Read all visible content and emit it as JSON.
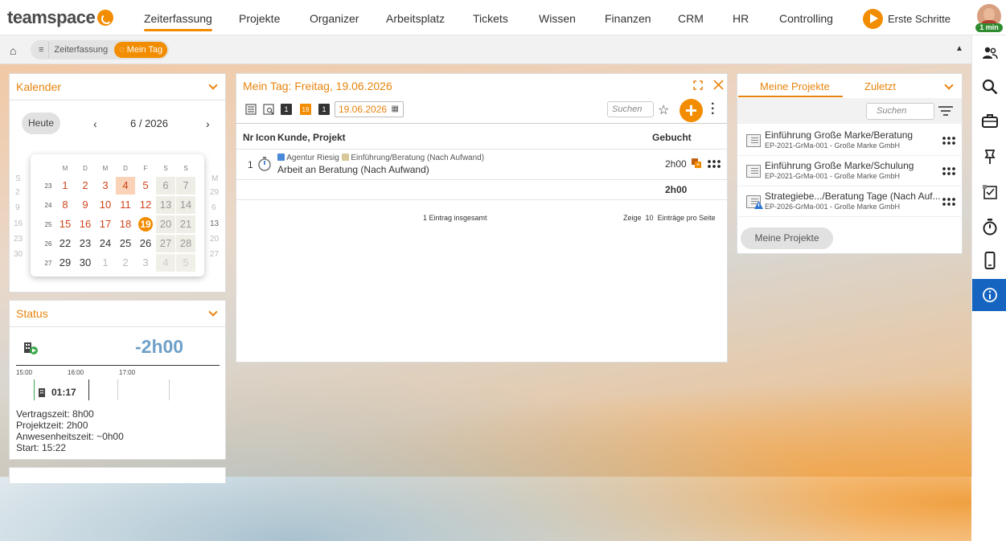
{
  "nav": {
    "logo": "teamspace",
    "items": [
      "Zeiterfassung",
      "Projekte",
      "Organizer",
      "Arbeitsplatz",
      "Tickets",
      "Wissen",
      "Finanzen",
      "CRM",
      "HR",
      "Controlling"
    ],
    "active": "Zeiterfassung",
    "erste_schritte": "Erste Schritte",
    "timer_badge": "1 min"
  },
  "breadcrumb": {
    "home_icon": "home-icon",
    "menu_glyph": "≡",
    "items": [
      "Zeiterfassung",
      "Mein Tag"
    ],
    "collapse_glyph": "▲"
  },
  "colors": {
    "accent": "#f28c00",
    "status_blue": "#6fa0c8",
    "active_sidebar": "#1565c0"
  },
  "kalender": {
    "title": "Kalender",
    "today_button": "Heute",
    "month": "6 / 2026",
    "prev": "‹",
    "next": "›",
    "weekday_headers": [
      "M",
      "D",
      "M",
      "D",
      "F",
      "S",
      "S"
    ],
    "weeks": [
      {
        "nr": "23",
        "days": [
          "1",
          "2",
          "3",
          "4",
          "5",
          "6",
          "7"
        ]
      },
      {
        "nr": "24",
        "days": [
          "8",
          "9",
          "10",
          "11",
          "12",
          "13",
          "14"
        ]
      },
      {
        "nr": "25",
        "days": [
          "15",
          "16",
          "17",
          "18",
          "19",
          "20",
          "21"
        ]
      },
      {
        "nr": "26",
        "days": [
          "22",
          "23",
          "24",
          "25",
          "26",
          "27",
          "28"
        ]
      },
      {
        "nr": "27",
        "days": [
          "29",
          "30",
          "1",
          "2",
          "3",
          "4",
          "5"
        ]
      }
    ],
    "ghost_left": {
      "header": "S",
      "days": [
        "2",
        "9",
        "16",
        "23",
        "30"
      ]
    },
    "ghost_right": {
      "header": "M",
      "days": [
        "29",
        "6",
        "13",
        "20",
        "27"
      ]
    }
  },
  "status": {
    "title": "Status",
    "balance": "-2h00",
    "timeline_labels": [
      "15:00",
      "16:00",
      "17:00"
    ],
    "current_duration": "01:17",
    "lines": [
      "Vertragszeit: 8h00",
      "Projektzeit: 2h00",
      "Anwesenheitszeit: ~0h00",
      "Start: 15:22"
    ]
  },
  "mein_tag": {
    "title": "Mein Tag: Freitag, 19.06.2026",
    "date_value": "19.06.2026",
    "toolbar_badges": [
      "1",
      "19",
      "1"
    ],
    "search_placeholder": "Suchen",
    "columns": {
      "nr": "Nr",
      "icon": "Icon",
      "kunde": "Kunde, Projekt",
      "gebucht": "Gebucht"
    },
    "rows": [
      {
        "nr": "1",
        "kunde": "Agentur Riesig",
        "projekt": "Einführung/Beratung (Nach Aufwand)",
        "taetigkeit": "Arbeit an Beratung (Nach Aufwand)",
        "gebucht": "2h00"
      }
    ],
    "total": "2h00",
    "count_text": "1 Eintrag insgesamt",
    "page_size_prefix": "Zeige",
    "page_size": "10",
    "page_size_suffix": "Einträge pro Seite"
  },
  "projekte": {
    "tabs": [
      "Meine Projekte",
      "Zuletzt"
    ],
    "search_placeholder": "Suchen",
    "items": [
      {
        "title": "Einführung Große Marke/Beratung",
        "sub": "EP-2021-GrMa-001 - Große Marke GmbH",
        "warn": false
      },
      {
        "title": "Einführung Große Marke/Schulung",
        "sub": "EP-2021-GrMa-001 - Große Marke GmbH",
        "warn": false
      },
      {
        "title": "Strategiebe.../Beratung Tage (Nach Auf...",
        "sub": "EP-2026-GrMa-001 - Große Marke GmbH",
        "warn": true
      }
    ],
    "button": "Meine Projekte"
  },
  "sidebar_icons": [
    "people-icon",
    "search-icon",
    "briefcase-icon",
    "pin-icon",
    "task-checklist-icon",
    "stopwatch-icon",
    "mobile-icon",
    "info-icon"
  ]
}
